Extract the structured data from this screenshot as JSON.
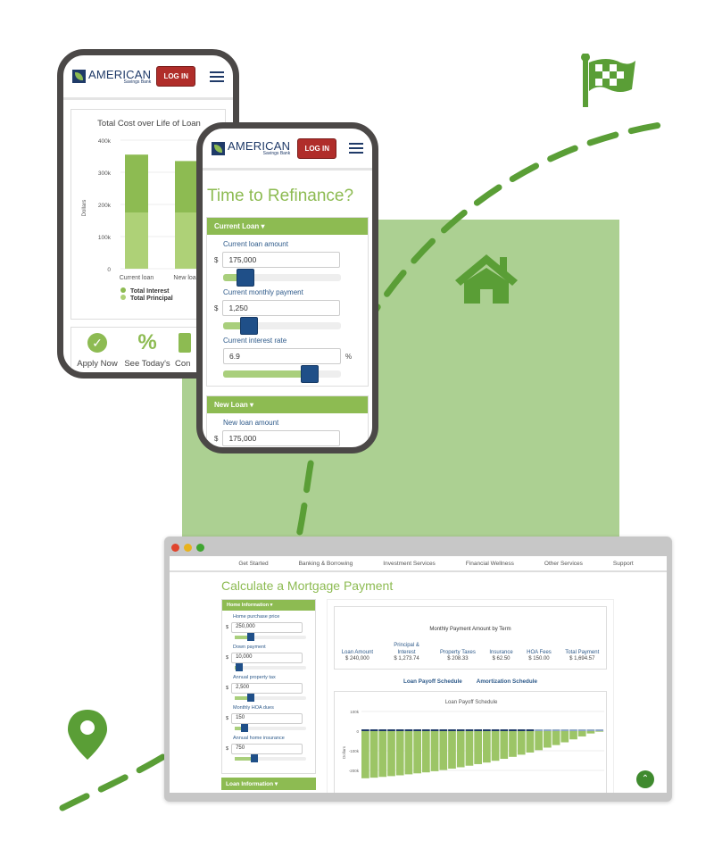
{
  "colors": {
    "accent_green": "#8dbb52",
    "dash_green": "#5a9e36",
    "navy": "#1f4f88",
    "login_red": "#b02d2a",
    "bg_square": "#acd092"
  },
  "decor_icons": [
    "checkered-flag-icon",
    "house-icon",
    "location-pin-icon"
  ],
  "brand": {
    "name": "AMERICAN",
    "sub": "Savings Bank",
    "login": "LOG IN"
  },
  "phone1": {
    "chart_data": {
      "type": "bar",
      "stacked": true,
      "title": "Total Cost over Life of Loan",
      "ylabel": "Dollars",
      "ylim": [
        0,
        400000
      ],
      "yticks": [
        "0",
        "100k",
        "200k",
        "300k",
        "400k"
      ],
      "categories": [
        "Current loan",
        "New loan"
      ],
      "series": [
        {
          "name": "Total Interest",
          "values": [
            180000,
            160000
          ],
          "color": "#8dbb52"
        },
        {
          "name": "Total Principal",
          "values": [
            175000,
            175000
          ],
          "color": "#aed177"
        }
      ]
    },
    "actions": [
      "Apply Now",
      "See Today's",
      "Con"
    ]
  },
  "phone2": {
    "title": "Time to Refinance?",
    "current_section": "Current Loan ▾",
    "fields": [
      {
        "label": "Current loan amount",
        "prefix": "$",
        "value": "175,000",
        "slider": 0.08
      },
      {
        "label": "Current monthly payment",
        "prefix": "$",
        "value": "1,250",
        "slider": 0.12
      },
      {
        "label": "Current interest rate",
        "suffix": "%",
        "value": "6.9",
        "slider": 0.72
      }
    ],
    "new_section": "New Loan ▾",
    "new_fields": [
      {
        "label": "New loan amount",
        "prefix": "$",
        "value": "175,000"
      }
    ]
  },
  "browser": {
    "nav": [
      "Get Started",
      "Banking & Borrowing",
      "Investment Services",
      "Financial Wellness",
      "Other Services",
      "Support"
    ],
    "title": "Calculate a Mortgage Payment",
    "home_section": "Home Information ▾",
    "loan_section": "Loan Information ▾",
    "fields": [
      {
        "label": "Home purchase price",
        "value": "250,000",
        "slider": 0.2
      },
      {
        "label": "Down payment",
        "value": "10,000",
        "slider": 0.02
      },
      {
        "label": "Annual property tax",
        "value": "2,500",
        "slider": 0.2
      },
      {
        "label": "Monthly HOA dues",
        "value": "150",
        "slider": 0.1
      },
      {
        "label": "Annual home insurance",
        "value": "750",
        "slider": 0.25
      }
    ],
    "summary_title": "Monthly Payment Amount by Term",
    "summary": [
      {
        "label": "Loan Amount",
        "value": "$ 240,000"
      },
      {
        "label": "Principal & Interest",
        "value": "$ 1,273.74"
      },
      {
        "label": "Property Taxes",
        "value": "$ 208.33"
      },
      {
        "label": "Insurance",
        "value": "$ 62.50"
      },
      {
        "label": "HOA Fees",
        "value": "$ 150.00"
      },
      {
        "label": "Total Payment",
        "value": "$ 1,694.57"
      }
    ],
    "tabs": [
      "Loan Payoff Schedule",
      "Amortization Schedule"
    ],
    "chart_data": {
      "type": "bar",
      "title": "Loan Payoff Schedule",
      "ylabel": "Dollars",
      "ylim": [
        -200000,
        100000
      ],
      "yticks": [
        "100k",
        "0",
        "-100k",
        "-200k"
      ],
      "values": [
        -240000,
        -237000,
        -233000,
        -229000,
        -225000,
        -220000,
        -215000,
        -210000,
        -204000,
        -198000,
        -191000,
        -184000,
        -176000,
        -168000,
        -160000,
        -151000,
        -141000,
        -131000,
        -120000,
        -109000,
        -97000,
        -84000,
        -71000,
        -57000,
        -42000,
        -27000,
        -12000,
        -3000
      ]
    }
  }
}
